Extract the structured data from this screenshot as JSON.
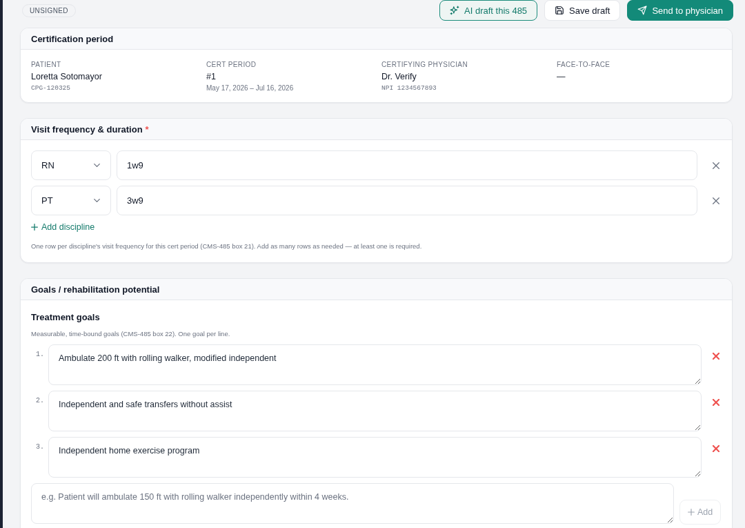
{
  "header": {
    "status_badge": "UNSIGNED",
    "actions": [
      {
        "label": "AI draft this 485",
        "kind": "ai"
      },
      {
        "label": "Save draft",
        "kind": "save"
      },
      {
        "label": "Send to physician",
        "kind": "send"
      }
    ]
  },
  "certification": {
    "title": "Certification period",
    "fields": [
      {
        "label": "PATIENT",
        "value": "Loretta Sotomayor",
        "code": "CPG-120325"
      },
      {
        "label": "CERT PERIOD",
        "value": "#1",
        "dates": "May 17, 2026 – Jul 16, 2026"
      },
      {
        "label": "CERTIFYING PHYSICIAN",
        "value": "Dr. Verify",
        "code": "NPI 1234567893"
      },
      {
        "label": "FACE-TO-FACE",
        "value": "—"
      }
    ]
  },
  "visit_frequency": {
    "title": "Visit frequency & duration",
    "required_mark": "*",
    "rows": [
      {
        "discipline": "RN",
        "frequency": "1w9"
      },
      {
        "discipline": "PT",
        "frequency": "3w9"
      }
    ],
    "add_label": "Add discipline",
    "help": "One row per discipline's visit frequency for this cert period (CMS-485 box 21). Add as many rows as needed — at least one is required."
  },
  "goals": {
    "title": "Goals / rehabilitation potential",
    "section_title": "Treatment goals",
    "help": "Measurable, time-bound goals (CMS-485 box 22). One goal per line.",
    "items": [
      {
        "number": "1.",
        "text": "Ambulate 200 ft with rolling walker, modified independent"
      },
      {
        "number": "2.",
        "text": "Independent and safe transfers without assist"
      },
      {
        "number": "3.",
        "text": "Independent home exercise program"
      }
    ],
    "new_goal": {
      "placeholder": "e.g. Patient will ambulate 150 ft with rolling walker independently within 4 weeks."
    },
    "add_button": {
      "label": "Add",
      "disabled": true
    }
  }
}
